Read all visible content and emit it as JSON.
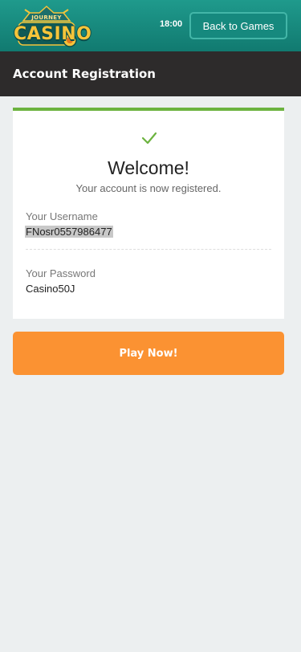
{
  "header": {
    "logo": {
      "top_text": "JOURNEY",
      "main_text": "CASINO",
      "icon": "casino-logo"
    },
    "clock": "18:00",
    "back_label": "Back to Games",
    "colors": {
      "teal": "#1a9083",
      "button_border": "#43b6a8"
    }
  },
  "title_bar": {
    "title": "Account Registration",
    "background": "#2d2b2b"
  },
  "card": {
    "accent": "#6cb33f",
    "check_icon": "checkmark-icon",
    "welcome": "Welcome!",
    "subtitle": "Your account is now registered.",
    "username_label": "Your Username",
    "username_value": "FNosr0557986477",
    "password_label": "Your Password",
    "password_value": "Casino50J"
  },
  "play_button": {
    "label": "Play Now!",
    "color": "#fb9232"
  }
}
